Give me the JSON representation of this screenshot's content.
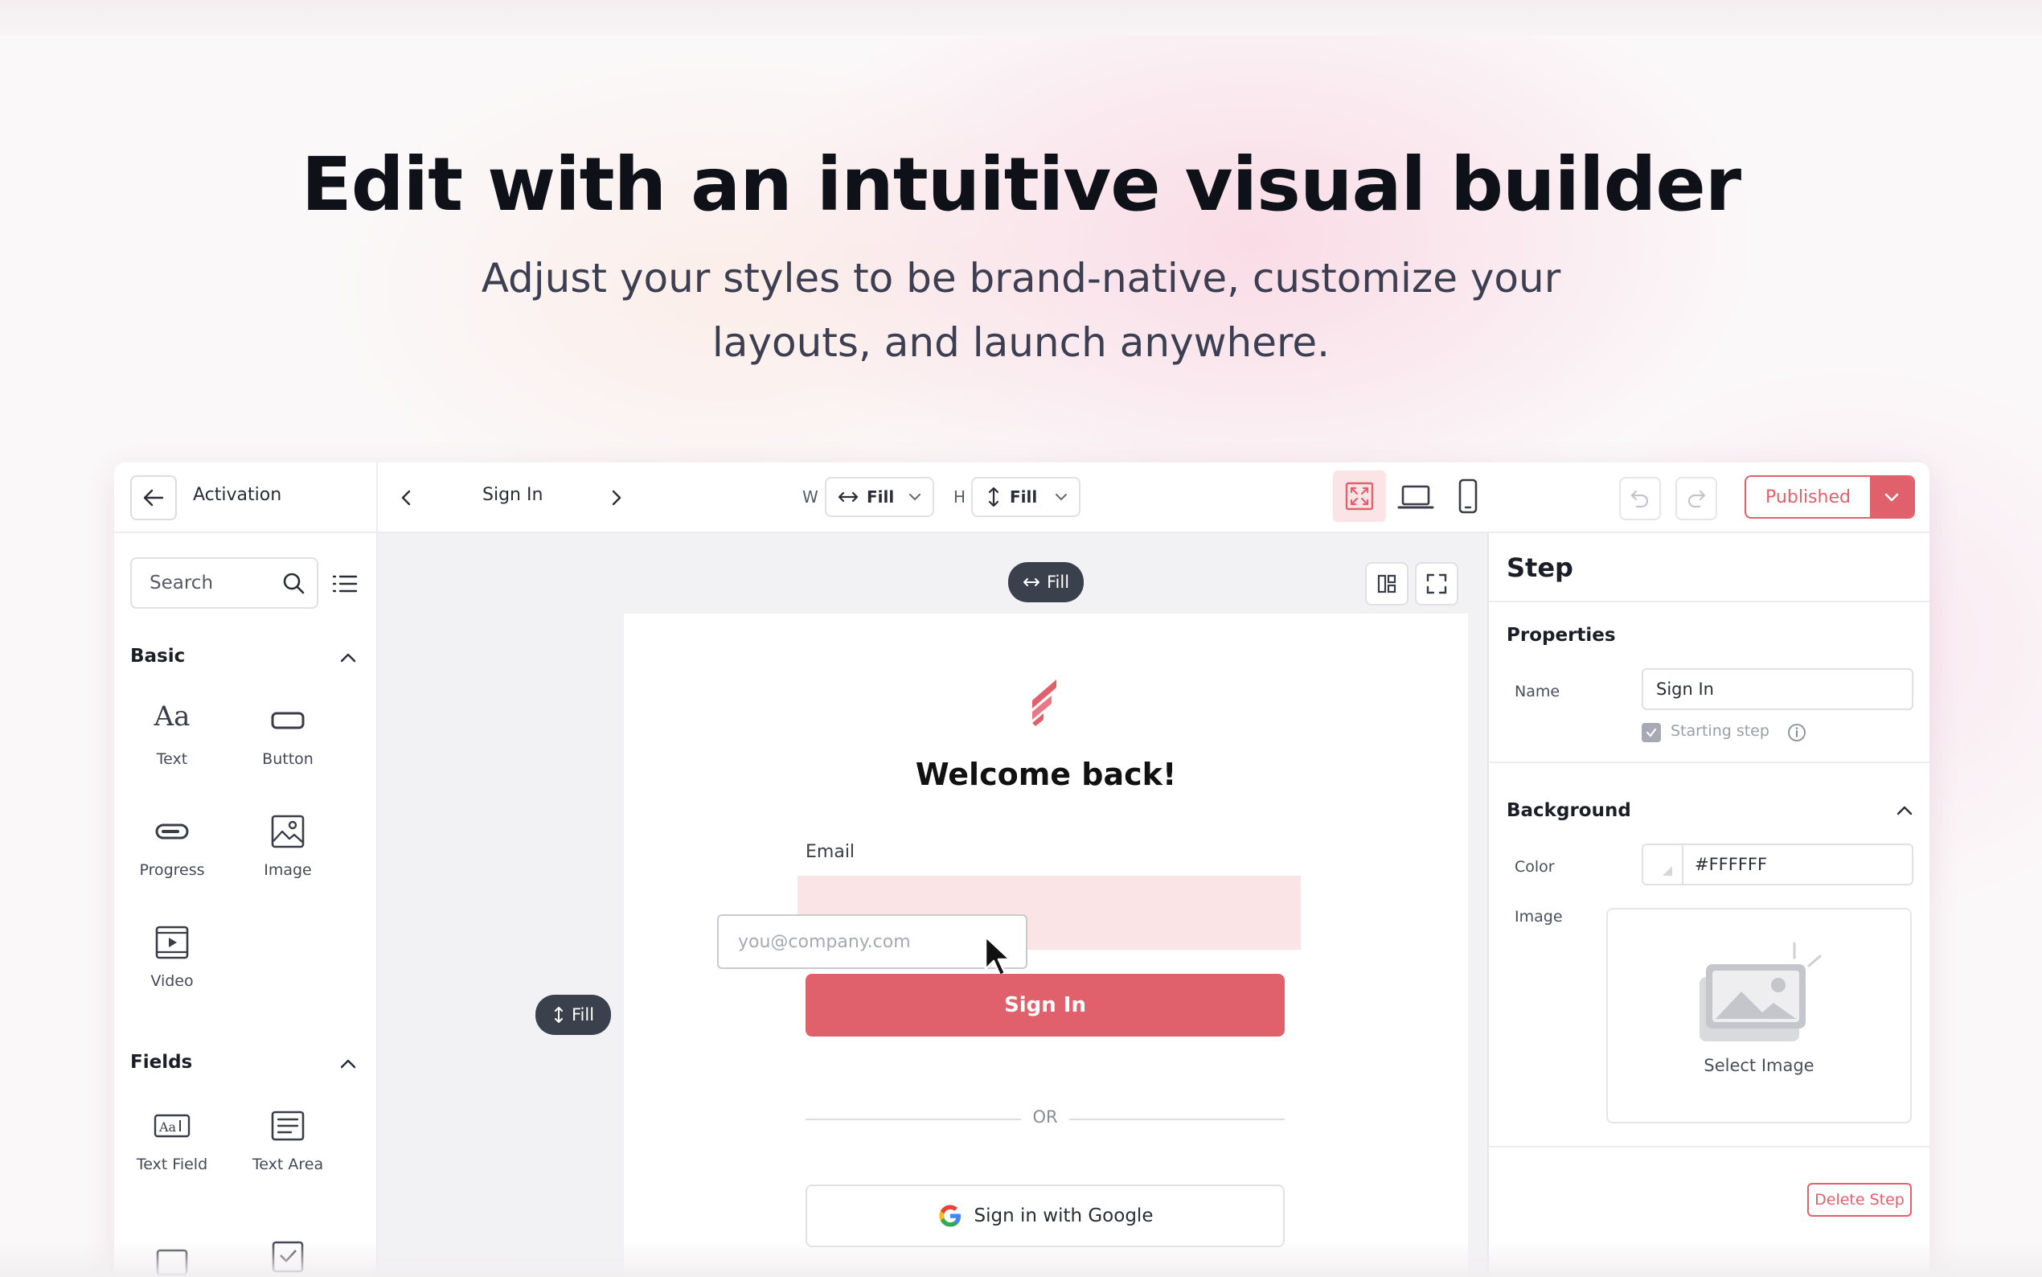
{
  "hero": {
    "title": "Edit with an intuitive visual builder",
    "subtitle_line1": "Adjust your styles to be brand-native, customize your",
    "subtitle_line2": "layouts, and launch anywhere."
  },
  "topbar": {
    "flow_name": "Activation",
    "step_name": "Sign In",
    "width_label": "W",
    "width_value": "Fill",
    "height_label": "H",
    "height_value": "Fill",
    "publish_label": "Published"
  },
  "sidebar": {
    "search_placeholder": "Search",
    "basic_title": "Basic",
    "basic_items": [
      {
        "label": "Text",
        "icon": "text-icon"
      },
      {
        "label": "Button",
        "icon": "button-icon"
      },
      {
        "label": "Progress",
        "icon": "progress-icon"
      },
      {
        "label": "Image",
        "icon": "image-icon"
      },
      {
        "label": "Video",
        "icon": "video-icon"
      }
    ],
    "fields_title": "Fields",
    "field_items": [
      {
        "label": "Text Field",
        "icon": "text-field-icon"
      },
      {
        "label": "Text Area",
        "icon": "text-area-icon"
      }
    ]
  },
  "canvas": {
    "width_pill": "Fill",
    "height_pill": "Fill",
    "welcome": "Welcome back!",
    "email_label": "Email",
    "email_placeholder": "you@company.com",
    "signin_button": "Sign In",
    "or_text": "OR",
    "google_button": "Sign in with Google"
  },
  "panel": {
    "title": "Step",
    "properties_title": "Properties",
    "name_label": "Name",
    "name_value": "Sign In",
    "starting_step_label": "Starting step",
    "background_title": "Background",
    "color_label": "Color",
    "color_value": "#FFFFFF",
    "image_label": "Image",
    "select_image": "Select Image",
    "delete_step": "Delete Step"
  },
  "colors": {
    "accent": "#e0606c",
    "accent_light": "#fbe4e6",
    "dark_pill": "#3a404c"
  }
}
